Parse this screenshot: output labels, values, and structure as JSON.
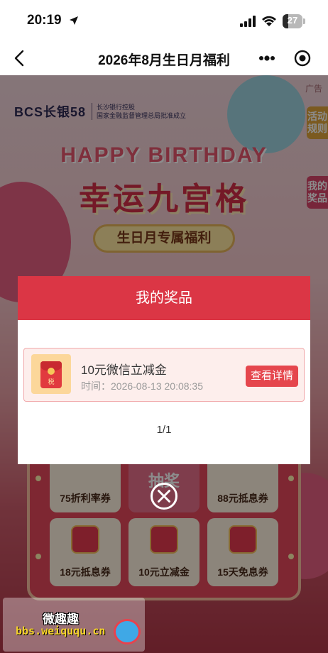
{
  "status_bar": {
    "time": "20:19",
    "battery": "27",
    "battery_level": 0.27
  },
  "nav": {
    "title": "2026年8月生日月福利"
  },
  "background": {
    "ad_label": "广告",
    "logo_mark": "BCS长银58",
    "logo_line1": "长沙银行控股",
    "logo_line2": "国家金融监督管理总局批准成立",
    "side_tabs": [
      "活动规则",
      "我的奖品"
    ],
    "hb_text": "HAPPY BIRTHDAY",
    "main_title": "幸运九宫格",
    "pill_text": "生日月专属福利",
    "grid_labels": [
      "75折利率券",
      "抽奖",
      "88元抵息券",
      "18元抵息券",
      "10元立减金",
      "15天免息券"
    ]
  },
  "modal": {
    "title": "我的奖品",
    "prize": {
      "icon_text": "税",
      "name": "10元微信立减金",
      "time": "时间：2026-08-13 20:08:35",
      "detail_button": "查看详情"
    },
    "pagination": "1/1"
  },
  "watermark": {
    "title": "微趣趣",
    "url": "bbs.weiququ.cn"
  },
  "colors": {
    "accent": "#db3645",
    "button": "#e5464d",
    "card_bg": "#fdeeec"
  }
}
